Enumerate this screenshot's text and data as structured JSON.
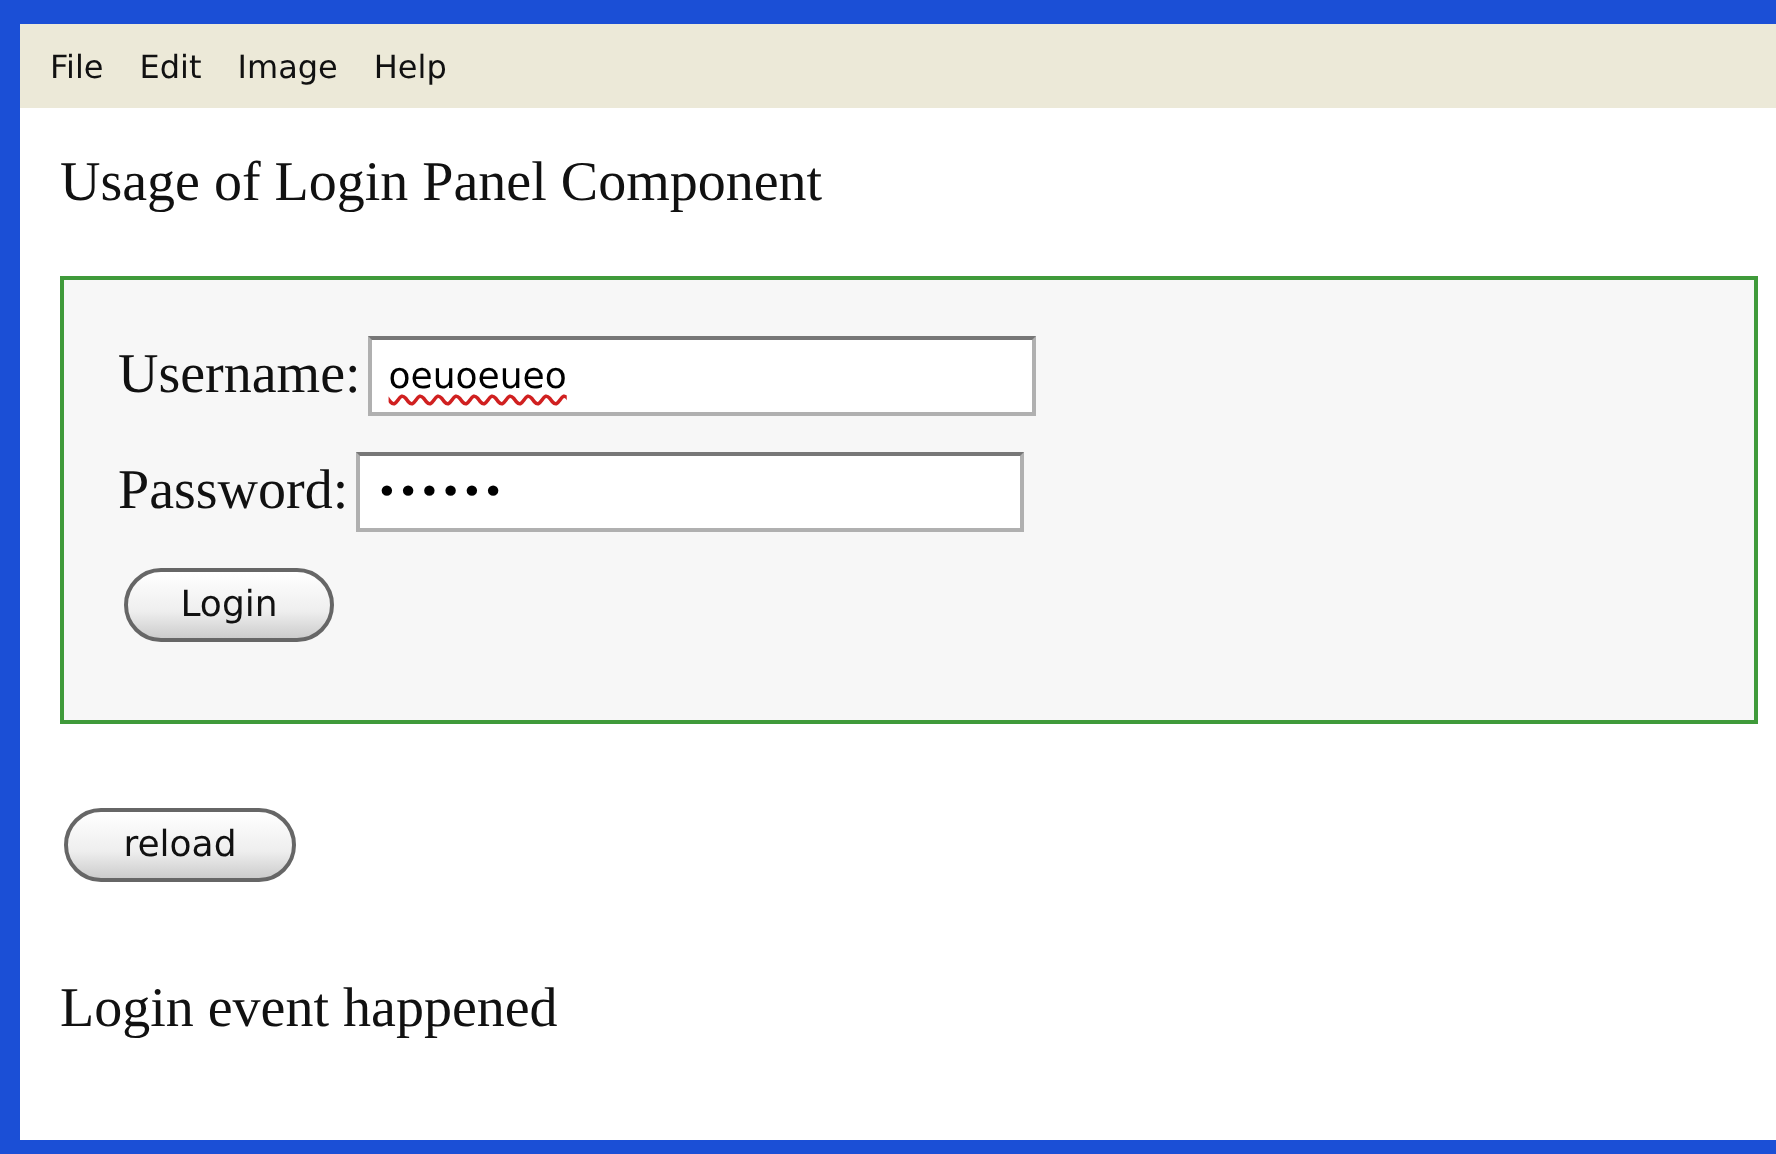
{
  "menu_bar": {
    "items": [
      "File",
      "Edit",
      "Image",
      "Help"
    ]
  },
  "heading": "Usage of Login Panel Component",
  "login_panel": {
    "fields": [
      {
        "label": "Username:",
        "value": "oeuoeueo",
        "spelling_error": true
      },
      {
        "label": "Password:",
        "value": "••••••",
        "spelling_error": false
      }
    ],
    "button": "Login"
  },
  "reload_button": "reload",
  "message": "Login event happened"
}
